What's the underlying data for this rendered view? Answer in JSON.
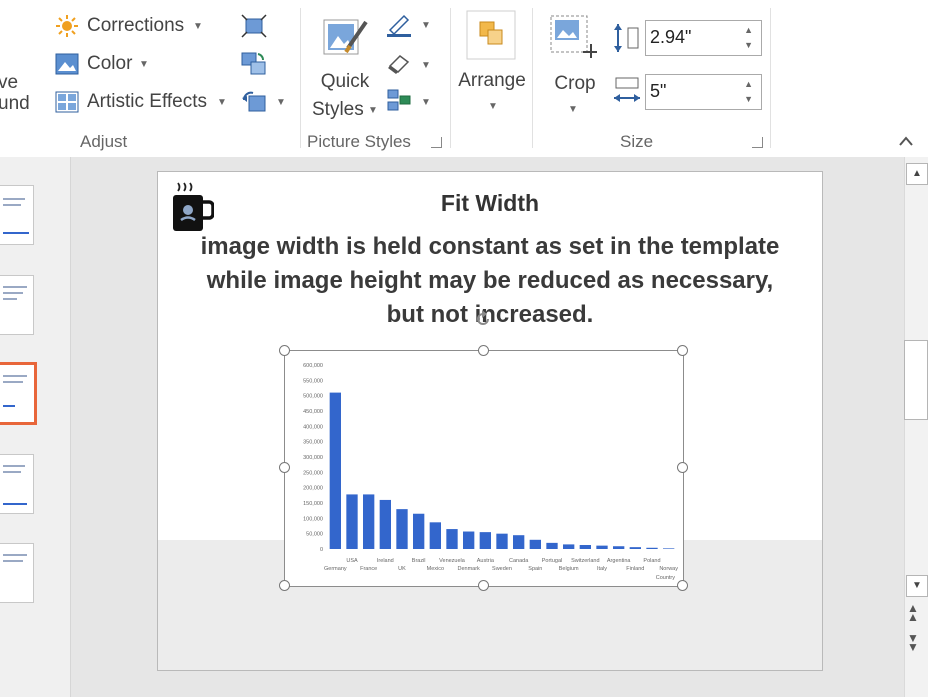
{
  "ribbon": {
    "adjust": {
      "remove_bg_line1": "ve",
      "remove_bg_line2": "und",
      "corrections": "Corrections",
      "color": "Color",
      "artistic_effects": "Artistic Effects",
      "group_name": "Adjust"
    },
    "picture_styles": {
      "quick_line1": "Quick",
      "quick_line2": "Styles",
      "group_name": "Picture Styles"
    },
    "arrange": {
      "label": "Arrange"
    },
    "size": {
      "crop": "Crop",
      "height_value": "2.94\"",
      "width_value": "5\"",
      "group_name": "Size"
    }
  },
  "slide": {
    "title": "Fit Width",
    "body": "image width is held constant as set in the template while image height may be reduced as necessary, but not increased."
  },
  "chart_data": {
    "type": "bar",
    "categories": [
      "Germany",
      "USA",
      "France",
      "Ireland",
      "UK",
      "Brazil",
      "Mexico",
      "Venezuela",
      "Denmark",
      "Austria",
      "Sweden",
      "Canada",
      "Spain",
      "Portugal",
      "Belgium",
      "Switzerland",
      "Italy",
      "Argentina",
      "Finland",
      "Poland",
      "Norway"
    ],
    "values": [
      510000,
      178000,
      178000,
      160000,
      130000,
      115000,
      87000,
      65000,
      57000,
      55000,
      50000,
      45000,
      30000,
      20000,
      15000,
      13000,
      11000,
      9000,
      6000,
      4000,
      2000
    ],
    "yticks": [
      "0",
      "50,000",
      "100,000",
      "150,000",
      "200,000",
      "250,000",
      "300,000",
      "350,000",
      "400,000",
      "450,000",
      "500,000",
      "550,000",
      "600,000"
    ],
    "ylim": [
      0,
      600000
    ],
    "xlabel": "Country",
    "color": "#3366cc"
  },
  "colors": {
    "accent": "#e8663a",
    "icon_blue": "#3a6fb7"
  }
}
